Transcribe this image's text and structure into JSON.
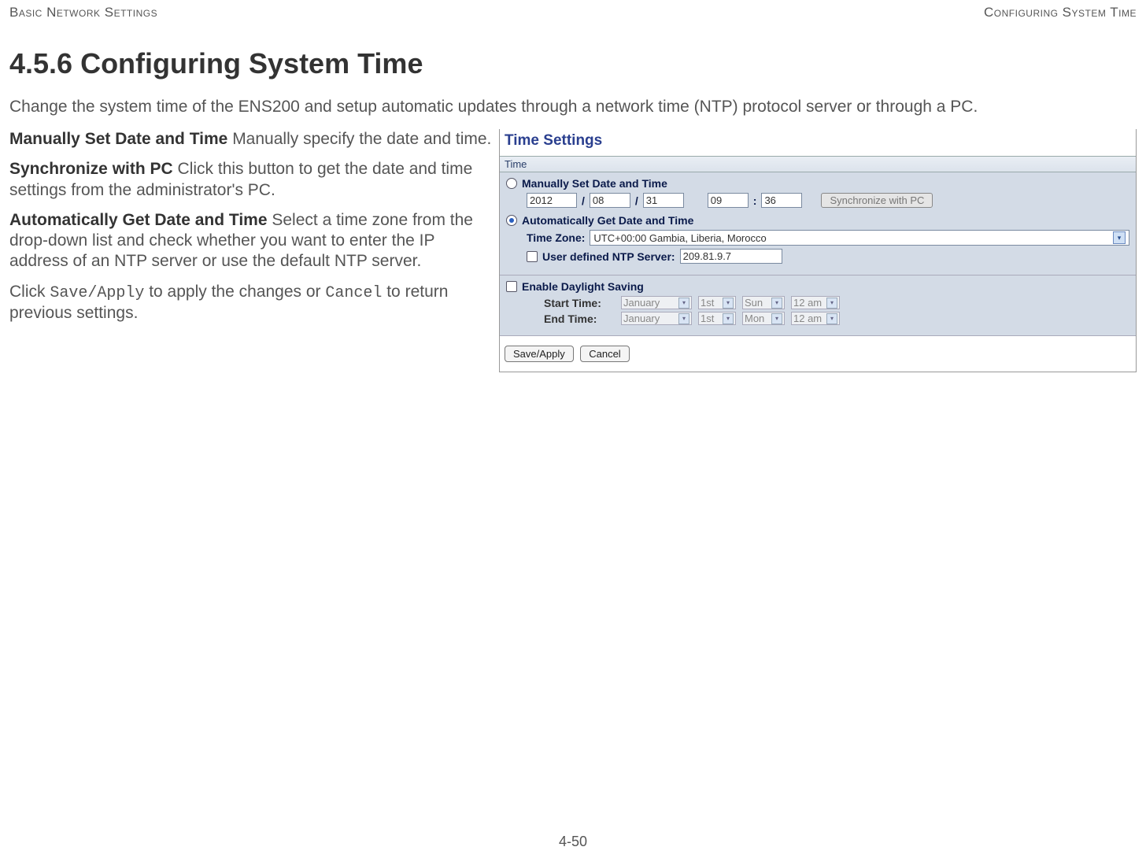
{
  "header": {
    "left": "Basic Network Settings",
    "right": "Configuring System Time"
  },
  "page": {
    "title": "4.5.6 Configuring System Time",
    "intro": "Change the system time of the ENS200 and setup automatic updates through a network time (NTP) protocol server or through a PC.",
    "footer": "4-50"
  },
  "desc": {
    "p1b": "Manually Set Date and Time",
    "p1": "  Manually specify the date and time.",
    "p2b": "Synchronize with PC",
    "p2": "  Click this button to get the date and time settings from the administrator's PC.",
    "p3b": "Automatically Get Date and Time",
    "p3": "  Select a time zone from the drop-down list and check whether you want to enter the IP address of an NTP server or use the default NTP server.",
    "p4a": "Click ",
    "p4m1": "Save/Apply",
    "p4b": " to apply the changes or ",
    "p4m2": "Cancel",
    "p4c": " to return previous settings."
  },
  "panel": {
    "title": "Time Settings",
    "time_section": "Time",
    "manual_label": "Manually Set Date and Time",
    "year": "2012",
    "month": "08",
    "day": "31",
    "hour": "09",
    "minute": "36",
    "sync_btn": "Synchronize with PC",
    "auto_label": "Automatically Get Date and Time",
    "tz_label": "Time Zone:",
    "tz_value": "UTC+00:00 Gambia, Liberia, Morocco",
    "ntp_label": "User defined NTP Server:",
    "ntp_value": "209.81.9.7",
    "dst_label": "Enable Daylight Saving",
    "start_label": "Start Time:",
    "end_label": "End Time:",
    "start": {
      "month": "January",
      "ord": "1st",
      "dow": "Sun",
      "hr": "12 am"
    },
    "end": {
      "month": "January",
      "ord": "1st",
      "dow": "Mon",
      "hr": "12 am"
    },
    "save_btn": "Save/Apply",
    "cancel_btn": "Cancel"
  }
}
